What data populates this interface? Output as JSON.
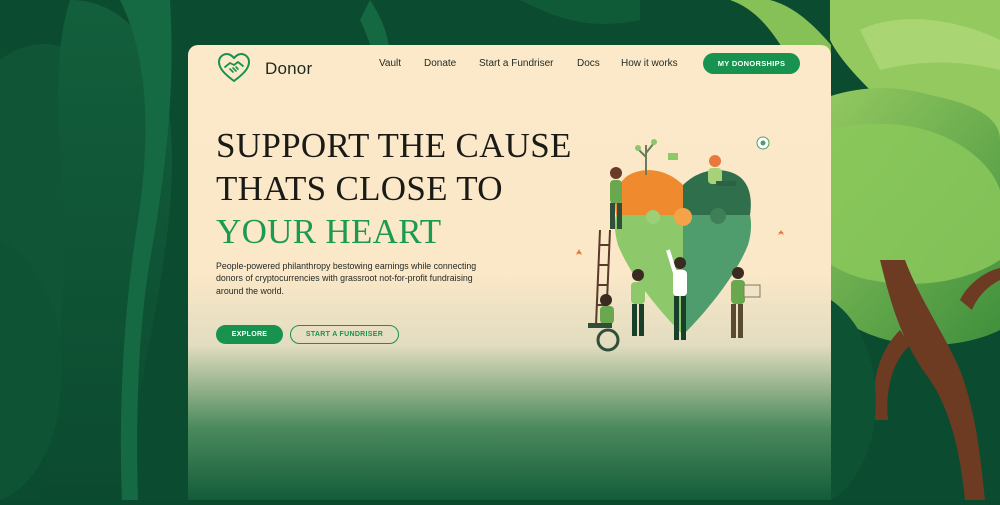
{
  "brand": {
    "name": "Donor",
    "logo_icon": "heart-handshake-icon"
  },
  "nav": {
    "links": [
      "Vault",
      "Donate",
      "Start a Fundriser",
      "Docs",
      "How it works"
    ],
    "cta": "MY DONORSHIPS"
  },
  "hero": {
    "line1": "SUPPORT THE CAUSE",
    "line2": "THATS CLOSE TO",
    "line3": "YOUR HEART",
    "description": "People-powered philanthropy bestowing earnings while connecting donors of cryptocurrencies with grassroot not-for-profit fundraising around the world.",
    "primary_button": "EXPLORE",
    "secondary_button": "START A FUNDRISER"
  },
  "colors": {
    "accent": "#17924f",
    "page_background": "#fbe9c9",
    "backdrop": "#0a4a2e"
  }
}
